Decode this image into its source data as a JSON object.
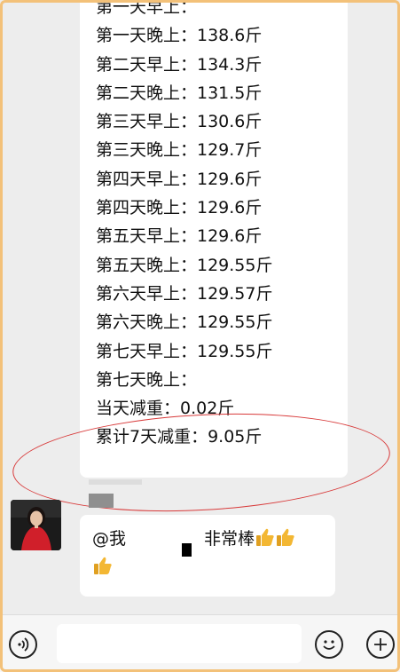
{
  "weight_log": {
    "cut_line": "第一天早上：",
    "lines": [
      "第一天晚上：138.6斤",
      "第二天早上：134.3斤",
      "第二天晚上：131.5斤",
      "第三天早上：130.6斤",
      "第三天晚上：129.7斤",
      "第四天早上：129.6斤",
      "第四天晚上：129.6斤",
      "第五天早上：129.6斤",
      "第五天晚上：129.55斤",
      "第六天早上：129.57斤",
      "第六天晚上：129.55斤",
      "第七天早上：129.55斤",
      "第七天晚上：",
      "当天减重：0.02斤",
      "累计7天减重：9.05斤"
    ]
  },
  "reply": {
    "mention": "@我",
    "text": "非常棒"
  },
  "icons": {
    "voice": "voice-icon",
    "emoji": "emoji-icon",
    "plus": "plus-icon",
    "thumbs": "thumbs-up-icon"
  },
  "colors": {
    "highlight_circle": "#d83a3a",
    "frame": "#f3c179"
  }
}
